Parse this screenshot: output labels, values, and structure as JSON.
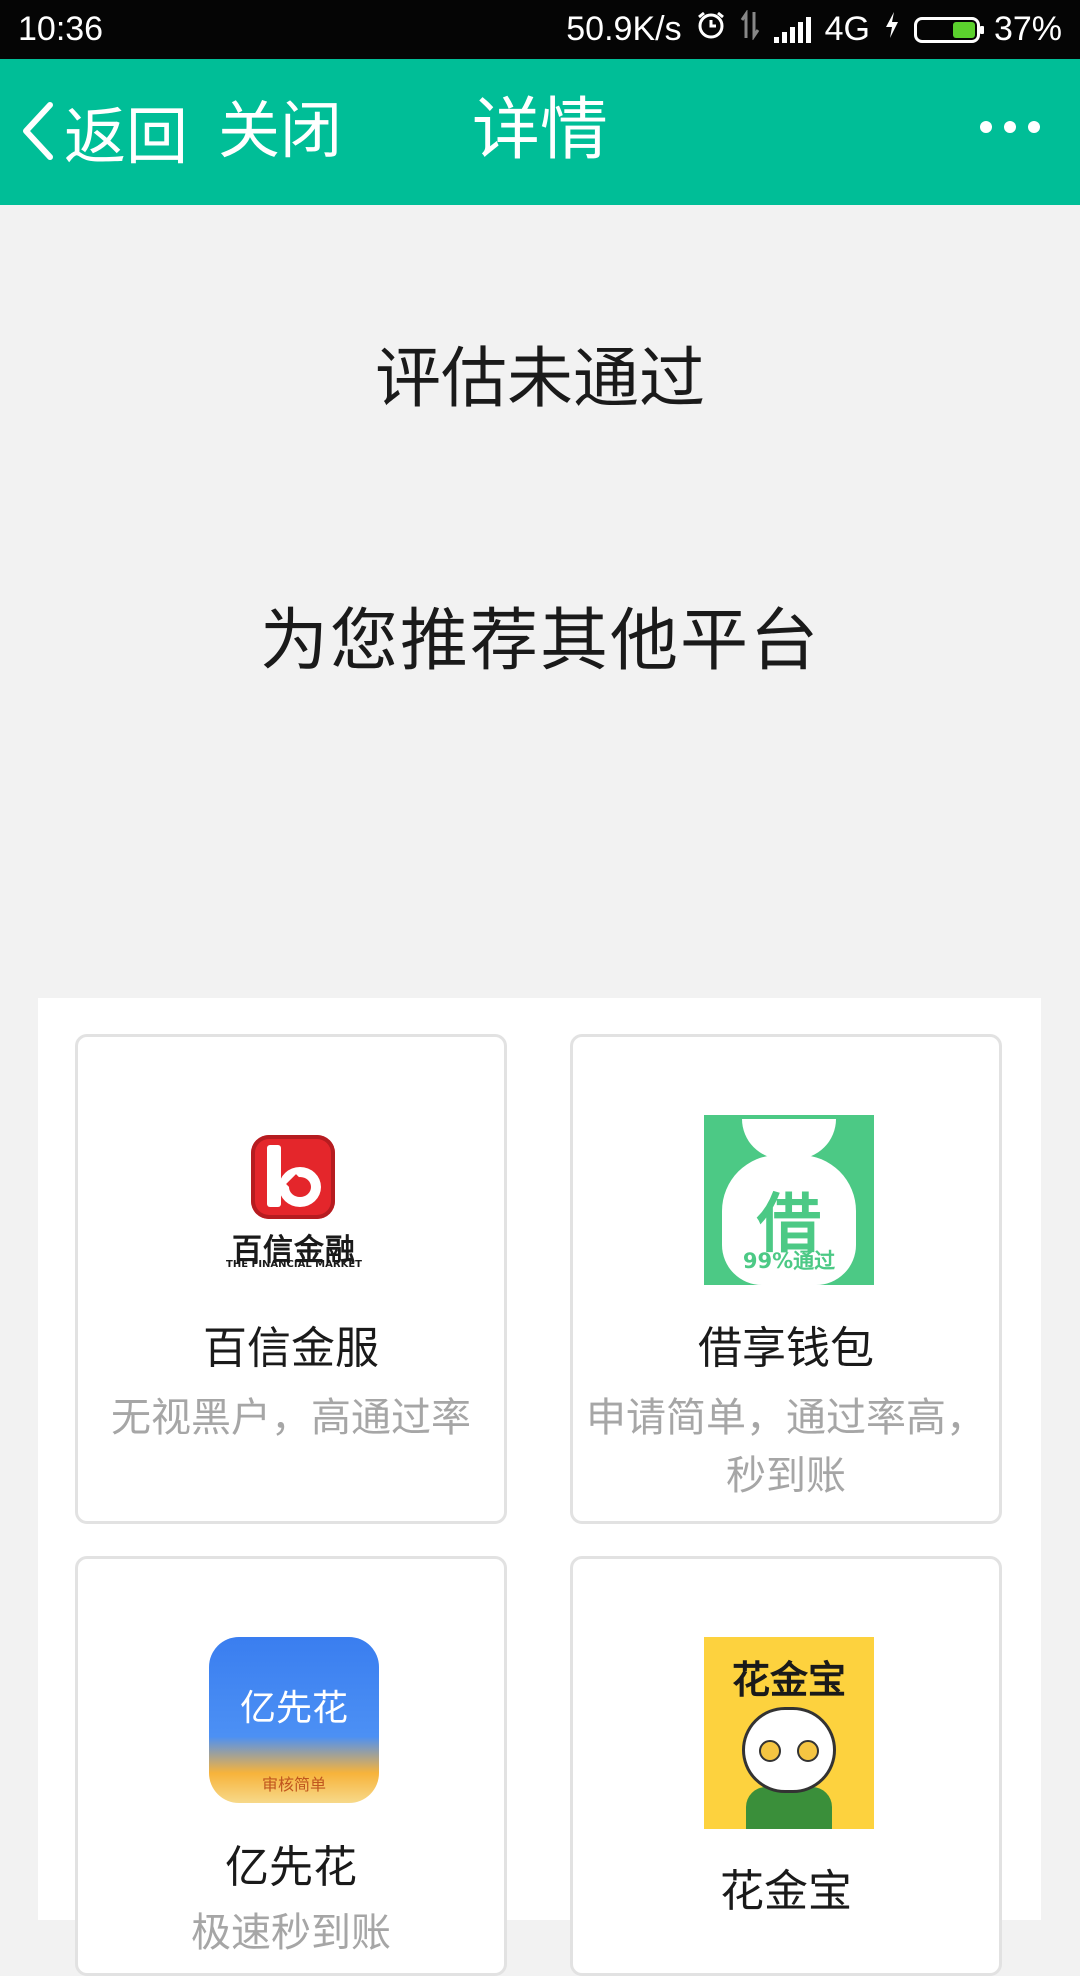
{
  "status_bar": {
    "time": "10:36",
    "speed": "50.9K/s",
    "network": "4G",
    "battery": "37%",
    "battery_level": 0.37
  },
  "nav": {
    "back_label": "返回",
    "close_label": "关闭",
    "title": "详情"
  },
  "main": {
    "status_title": "评估未通过",
    "recommend_title": "为您推荐其他平台"
  },
  "platforms": [
    {
      "name": "百信金服",
      "desc": "无视黑户，高通过率",
      "logo_text": "百信金融",
      "logo_subtext": "THE FINANCIAL MARKET",
      "logo_color": "#e4262b"
    },
    {
      "name": "借享钱包",
      "desc": "申请简单，通过率高，秒到账",
      "logo_text": "借",
      "logo_subtext": "99%通过",
      "logo_color": "#4cc985"
    },
    {
      "name": "亿先花",
      "desc": "极速秒到账",
      "logo_text": "亿先花",
      "logo_subtext": "审核简单",
      "logo_color": "#3a7ef0"
    },
    {
      "name": "花金宝",
      "desc": "",
      "logo_text": "花金宝",
      "logo_color": "#fdd23e"
    }
  ],
  "colors": {
    "nav_bg": "#00be97",
    "page_bg": "#f2f2f2",
    "desc_text": "#a6a6a6"
  }
}
